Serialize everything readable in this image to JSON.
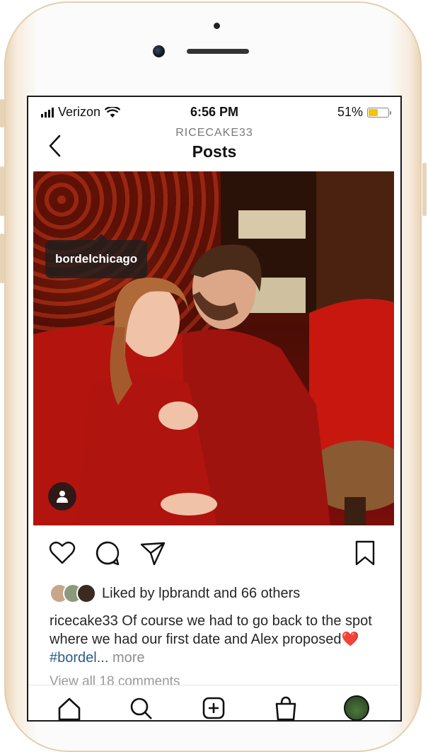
{
  "status_bar": {
    "carrier": "Verizon",
    "time": "6:56 PM",
    "battery_percent": "51%",
    "battery_level": 0.51,
    "battery_color": "#f5c400"
  },
  "header": {
    "username": "RICECAKE33",
    "title": "Posts",
    "back_icon": "chevron-left-icon"
  },
  "post": {
    "location_tag": "bordelchicago",
    "user_tag_icon": "person-icon",
    "actions": [
      "heart-icon",
      "comment-icon",
      "share-icon",
      "bookmark-icon"
    ],
    "likes": {
      "prefix": "Liked by",
      "user": "lpbrandt",
      "middle": "and",
      "others": "66 others"
    },
    "caption": {
      "username": "ricecake33",
      "text": "Of course we had to go back to the spot where we had our first date and Alex proposed",
      "emoji": "❤️",
      "hashtag": "#bordel...",
      "more": "more"
    },
    "view_comments": "View all 18 comments"
  },
  "tabbar": {
    "icons": [
      "home-icon",
      "search-icon",
      "add-post-icon",
      "shop-icon",
      "profile-avatar"
    ]
  },
  "colors": {
    "link": "#2b5c8c",
    "muted": "#8e8e8e",
    "text": "#262626"
  }
}
